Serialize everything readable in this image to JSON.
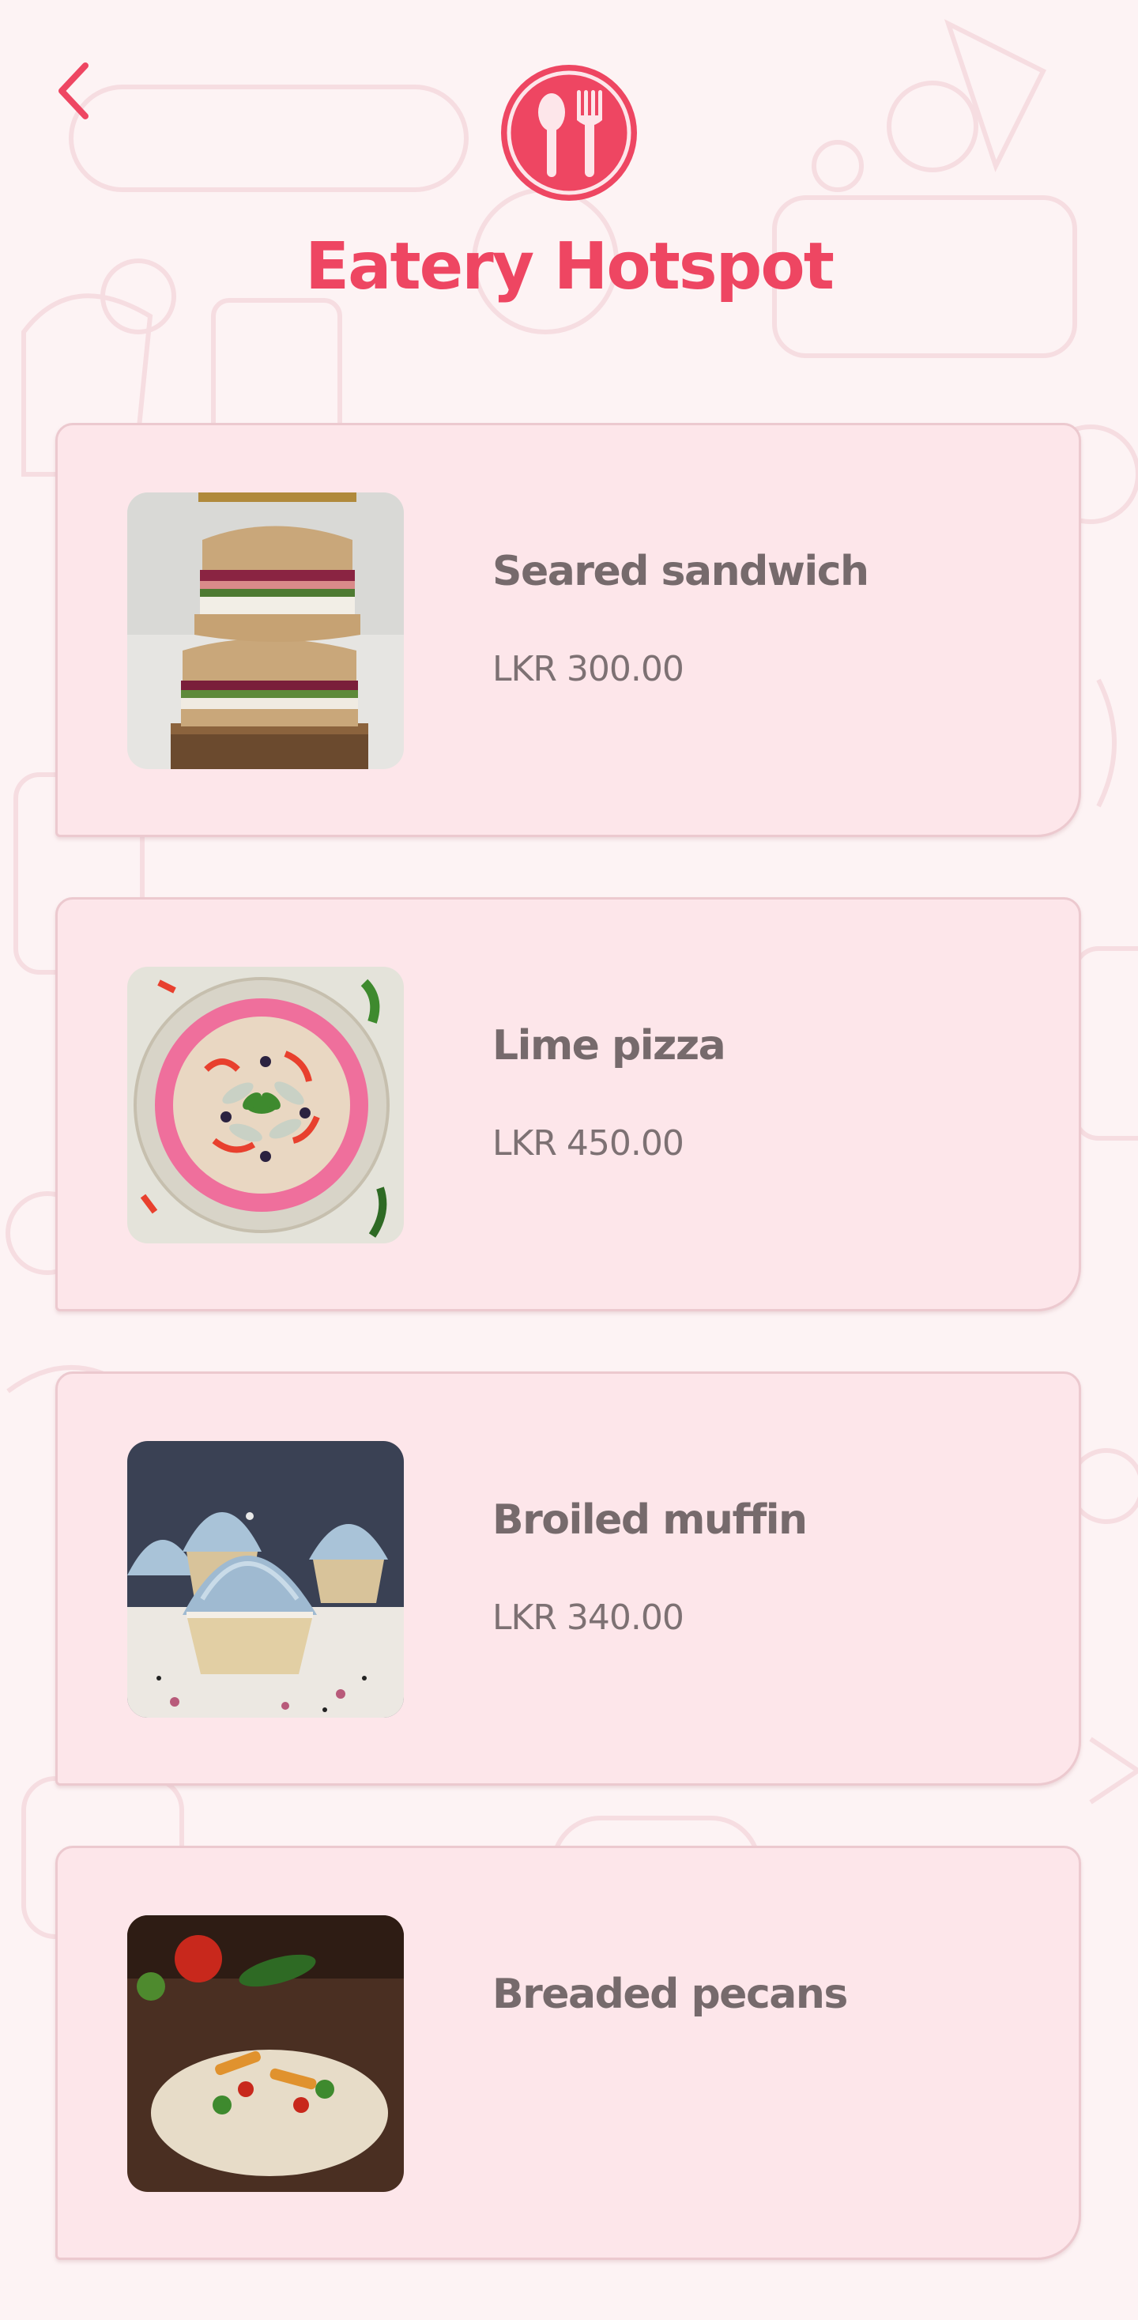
{
  "header": {
    "back_icon": "chevron-left-icon",
    "logo_icon": "spoon-fork-icon",
    "title": "Eatery Hotspot"
  },
  "theme": {
    "accent": "#ee4662",
    "card_bg": "#fde6ea",
    "card_border": "#ecc9cf",
    "text": "#766a6c",
    "page_bg": "#fdf3f4"
  },
  "menu": {
    "items": [
      {
        "name": "Seared sandwich",
        "price": "LKR 300.00",
        "image": "sandwich"
      },
      {
        "name": "Lime pizza",
        "price": "LKR 450.00",
        "image": "pizza"
      },
      {
        "name": "Broiled muffin",
        "price": "LKR 340.00",
        "image": "cupcakes"
      },
      {
        "name": "Breaded pecans",
        "price": "",
        "image": "salad-platter"
      }
    ]
  }
}
